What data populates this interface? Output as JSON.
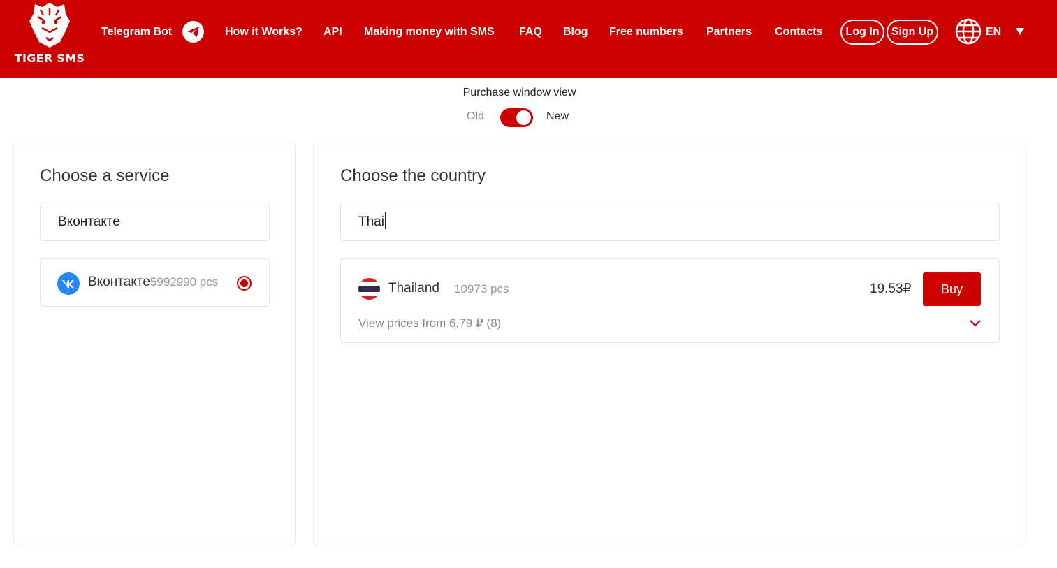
{
  "header": {
    "logo_text": "TIGER SMS",
    "nav": [
      {
        "label": "Telegram Bot"
      },
      {
        "label": "How it Works?"
      },
      {
        "label": "API"
      },
      {
        "label": "Making money with SMS"
      },
      {
        "label": "FAQ"
      },
      {
        "label": "Blog"
      },
      {
        "label": "Free numbers"
      },
      {
        "label": "Partners"
      },
      {
        "label": "Contacts"
      }
    ],
    "login_label": "Log In",
    "signup_label": "Sign Up",
    "language": "EN",
    "brand_color": "#cd0000"
  },
  "view_toggle": {
    "label": "Purchase window view",
    "option_old": "Old",
    "option_new": "New",
    "state": "New"
  },
  "service_panel": {
    "title": "Choose a service",
    "search_value": "Вконтакте",
    "items": [
      {
        "name": "Вконтакте",
        "count": "5992990 pcs",
        "icon": "vk-icon",
        "selected": true
      }
    ]
  },
  "country_panel": {
    "title": "Choose the country",
    "search_value": "Thai",
    "items": [
      {
        "name": "Thailand",
        "count": "10973 pcs",
        "price": "19.53₽",
        "buy_label": "Buy",
        "view_prices": "View prices from 6.79 ₽ (8)",
        "flag": "thailand-flag-icon"
      }
    ]
  }
}
